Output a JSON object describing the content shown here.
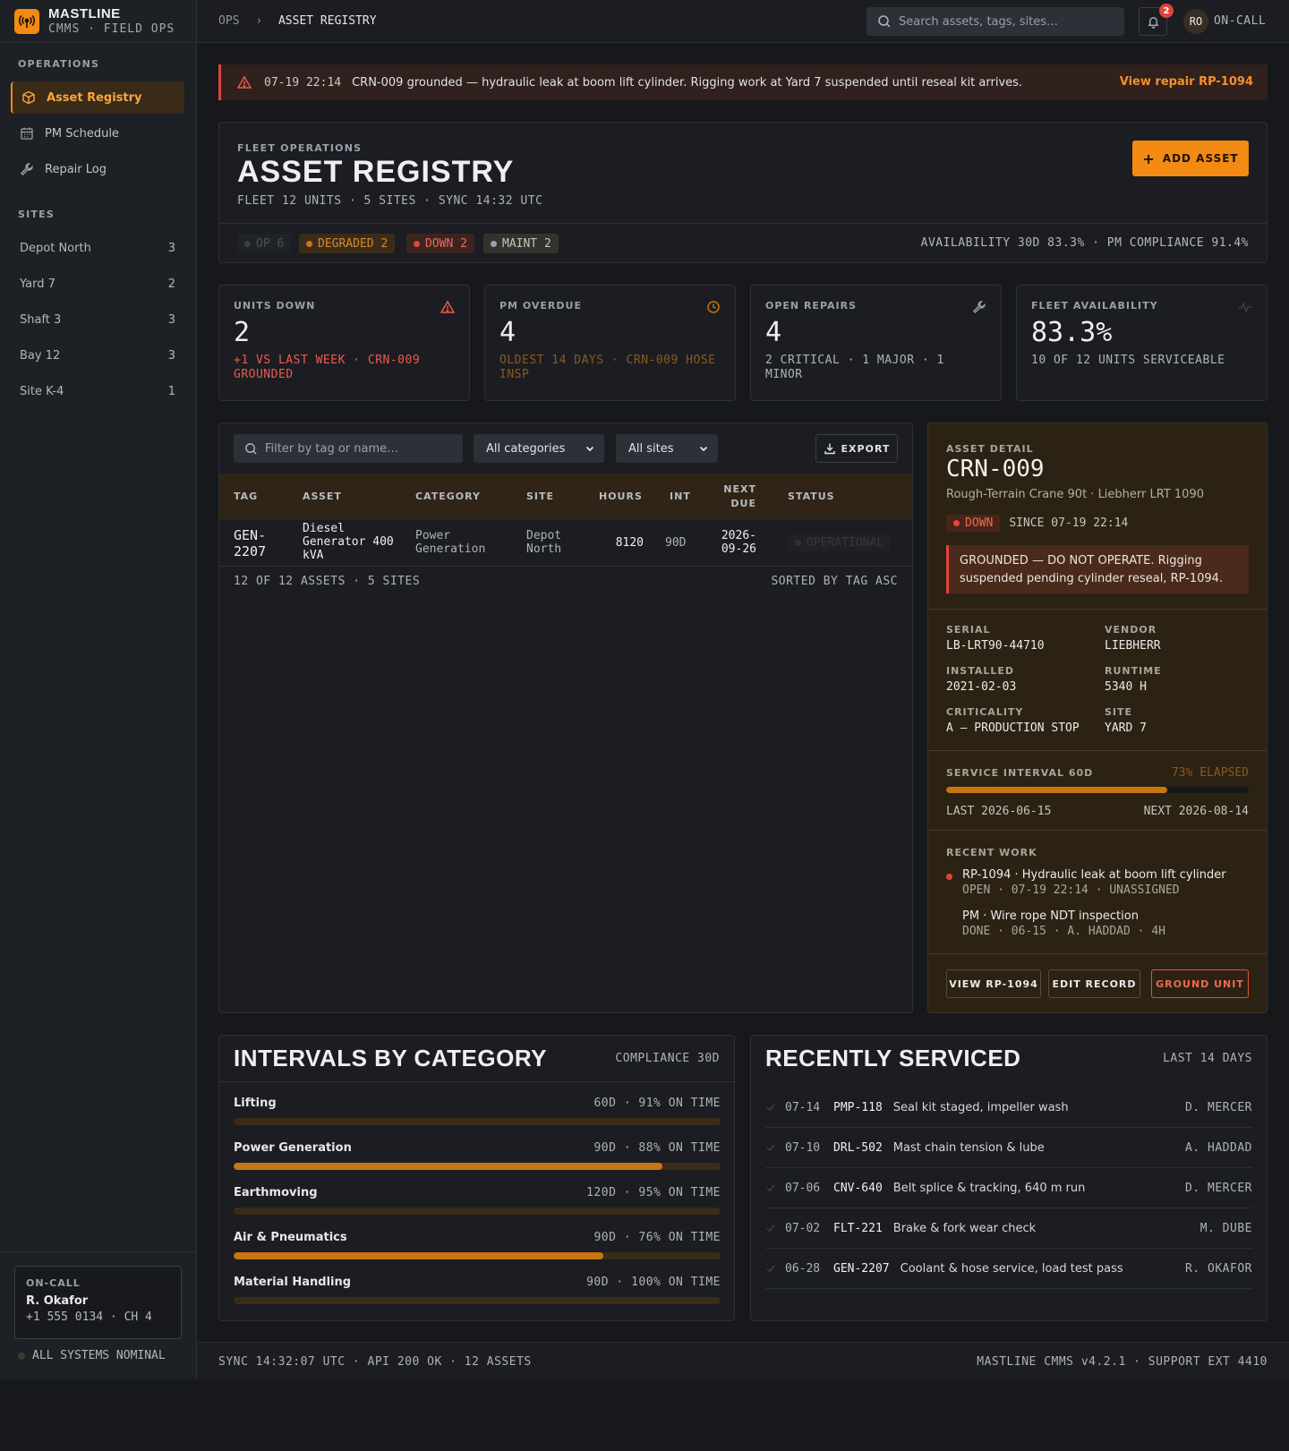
{
  "brand": {
    "name": "MASTLINE",
    "sub": "CMMS · FIELD OPS"
  },
  "sidebar": {
    "operations_label": "OPERATIONS",
    "nav": [
      {
        "label": "Asset Registry",
        "icon": "cube-icon",
        "active": true
      },
      {
        "label": "PM Schedule",
        "icon": "calendar-icon",
        "active": false
      },
      {
        "label": "Repair Log",
        "icon": "wrench-icon",
        "active": false
      }
    ],
    "sites_label": "SITES",
    "sites": [
      {
        "name": "Depot North",
        "count": "3"
      },
      {
        "name": "Yard 7",
        "count": "2"
      },
      {
        "name": "Shaft 3",
        "count": "3"
      },
      {
        "name": "Bay 12",
        "count": "3"
      },
      {
        "name": "Site K-4",
        "count": "1"
      }
    ],
    "oncall": {
      "label": "ON-CALL",
      "name": "R. Okafor",
      "phone": "+1 555 0134 · CH 4"
    },
    "system_status": "ALL SYSTEMS NOMINAL"
  },
  "topbar": {
    "crumb_root": "OPS",
    "crumb_current": "ASSET REGISTRY",
    "search_placeholder": "Search assets, tags, sites…",
    "notif_count": "2",
    "avatar": "RO",
    "status": "ON-CALL"
  },
  "alert": {
    "time": "07-19 22:14",
    "message": "CRN-009 grounded — hydraulic leak at boom lift cylinder. Rigging work at Yard 7 suspended until reseal kit arrives.",
    "link": "View repair RP-1094"
  },
  "header": {
    "eyebrow": "FLEET OPERATIONS",
    "title": "ASSET REGISTRY",
    "subtitle": "FLEET 12 UNITS · 5 SITES · SYNC 14:32 UTC",
    "add_button": "ADD ASSET",
    "pills": [
      {
        "label": "OP 6",
        "color": "#4a4f57",
        "bg": "#1f2227",
        "text": "#4c5158"
      },
      {
        "label": "DEGRADED 2",
        "color": "#c87512",
        "bg": "#3a2c1a",
        "text": "#d58a2c"
      },
      {
        "label": "DOWN 2",
        "color": "#e0443b",
        "bg": "#3d2420",
        "text": "#ee6a5a"
      },
      {
        "label": "MAINT 2",
        "color": "#9aa0a8",
        "bg": "#33332d",
        "text": "#c5c2ba"
      }
    ],
    "availability": "AVAILABILITY 30D 83.3% · PM COMPLIANCE 91.4%"
  },
  "kpis": [
    {
      "label": "UNITS DOWN",
      "value": "2",
      "sub": "+1 VS LAST WEEK · CRN-009 GROUNDED",
      "sub_color": "#ee5a4a",
      "icon": "warning-icon"
    },
    {
      "label": "PM OVERDUE",
      "value": "4",
      "sub": "OLDEST 14 DAYS · CRN-009 HOSE INSP",
      "sub_color": "#8a5a1e",
      "icon": "clock-icon"
    },
    {
      "label": "OPEN REPAIRS",
      "value": "4",
      "sub": "2 CRITICAL · 1 MAJOR · 1 MINOR",
      "sub_color": "#aeb2b8",
      "icon": "wrench-icon"
    },
    {
      "label": "FLEET AVAILABILITY",
      "value": "83.3%",
      "sub": "10 OF 12 UNITS SERVICEABLE",
      "sub_color": "#aeb2b8",
      "icon": "pulse-icon"
    }
  ],
  "table": {
    "filter_placeholder": "Filter by tag or name…",
    "category_select": "All categories",
    "site_select": "All sites",
    "export_label": "EXPORT",
    "columns": {
      "tag": "TAG",
      "asset": "ASSET",
      "category": "CATEGORY",
      "site": "SITE",
      "hours": "HOURS",
      "int": "INT",
      "next_due": "NEXT DUE",
      "status": "STATUS"
    },
    "rows": [
      {
        "tag": "GEN-2207",
        "asset": "Diesel Generator 400 kVA",
        "category": "Power Generation",
        "site": "Depot North",
        "hours": "8120",
        "int": "90D",
        "next_due": "2026-09-26",
        "status": "OPERATIONAL"
      }
    ],
    "footer_left": "12 OF 12 ASSETS · 5 SITES",
    "footer_right": "SORTED BY TAG ASC"
  },
  "detail": {
    "eyebrow": "ASSET DETAIL",
    "tag": "CRN-009",
    "name": "Rough-Terrain Crane 90t · Liebherr LRT 1090",
    "status": "DOWN",
    "since": "SINCE 07-19 22:14",
    "warning": "GROUNDED — DO NOT OPERATE. Rigging suspended pending cylinder reseal, RP-1094.",
    "fields": {
      "serial_label": "SERIAL",
      "serial": "LB-LRT90-44710",
      "vendor_label": "VENDOR",
      "vendor": "LIEBHERR",
      "installed_label": "INSTALLED",
      "installed": "2021-02-03",
      "runtime_label": "RUNTIME",
      "runtime": "5340 H",
      "criticality_label": "CRITICALITY",
      "criticality": "A — PRODUCTION STOP",
      "site_label": "SITE",
      "site": "YARD 7"
    },
    "interval": {
      "label": "SERVICE INTERVAL 60D",
      "elapsed": "73% ELAPSED",
      "progress": 0.73,
      "last": "LAST 2026-06-15",
      "next": "NEXT 2026-08-14"
    },
    "recent_label": "RECENT WORK",
    "recent": [
      {
        "title": "RP-1094 · Hydraulic leak at boom lift cylinder",
        "meta": "OPEN · 07-19 22:14 · UNASSIGNED"
      },
      {
        "title": "PM · Wire rope NDT inspection",
        "meta": "DONE · 06-15 · A. HADDAD · 4H"
      }
    ],
    "buttons": {
      "view": "VIEW RP-1094",
      "edit": "EDIT RECORD",
      "ground": "GROUND UNIT"
    }
  },
  "intervals": {
    "title": "INTERVALS BY CATEGORY",
    "meta": "COMPLIANCE 30D",
    "rows": [
      {
        "name": "Lifting",
        "meta": "60D · 91% ON TIME",
        "fill": 0
      },
      {
        "name": "Power Generation",
        "meta": "90D · 88% ON TIME",
        "fill": 0.88
      },
      {
        "name": "Earthmoving",
        "meta": "120D · 95% ON TIME",
        "fill": 0
      },
      {
        "name": "Air & Pneumatics",
        "meta": "90D · 76% ON TIME",
        "fill": 0.76
      },
      {
        "name": "Material Handling",
        "meta": "90D · 100% ON TIME",
        "fill": 0
      }
    ]
  },
  "serviced": {
    "title": "RECENTLY SERVICED",
    "meta": "LAST 14 DAYS",
    "rows": [
      {
        "date": "07-14",
        "tag": "PMP-118",
        "desc": "Seal kit staged, impeller wash",
        "tech": "D. MERCER"
      },
      {
        "date": "07-10",
        "tag": "DRL-502",
        "desc": "Mast chain tension & lube",
        "tech": "A. HADDAD"
      },
      {
        "date": "07-06",
        "tag": "CNV-640",
        "desc": "Belt splice & tracking, 640 m run",
        "tech": "D. MERCER"
      },
      {
        "date": "07-02",
        "tag": "FLT-221",
        "desc": "Brake & fork wear check",
        "tech": "M. DUBE"
      },
      {
        "date": "06-28",
        "tag": "GEN-2207",
        "desc": "Coolant & hose service, load test pass",
        "tech": "R. OKAFOR"
      }
    ]
  },
  "footer": {
    "left": "SYNC 14:32:07 UTC · API 200 OK · 12 ASSETS",
    "right": "MASTLINE CMMS v4.2.1 · SUPPORT EXT 4410"
  }
}
